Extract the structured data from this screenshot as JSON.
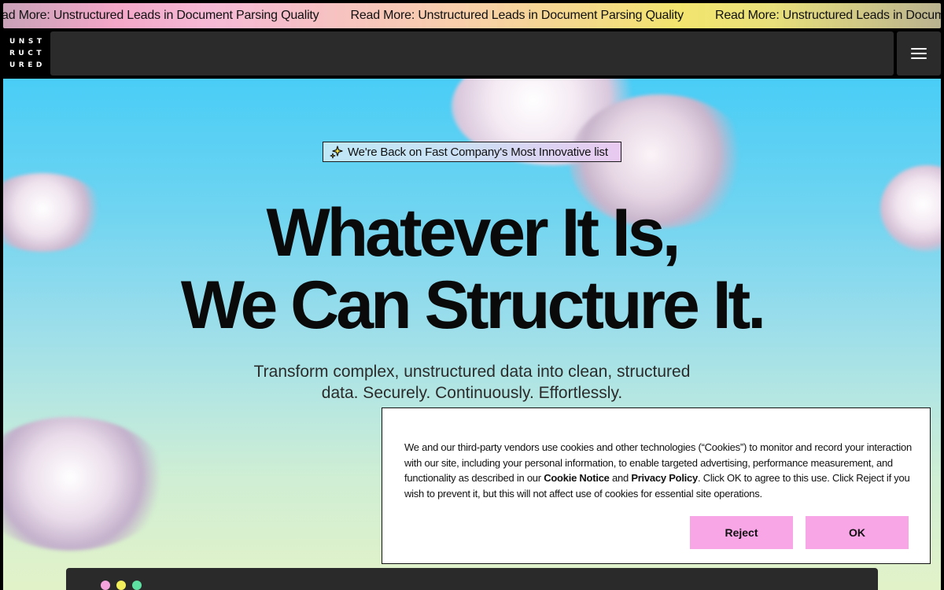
{
  "ticker": {
    "items": [
      "Read More: Unstructured Leads in Document Parsing Quality",
      "Read More: Unstructured Leads in Document Parsing Quality",
      "Read More: Unstructured Leads in Document Parsing Quality"
    ]
  },
  "logo": {
    "lines": [
      "UNST",
      "RUCT",
      "URED"
    ]
  },
  "nav": {
    "menu_icon": "hamburger-icon"
  },
  "hero": {
    "badge": {
      "icon": "sparkle-icon",
      "text": "We're Back on Fast Company's Most Innovative list"
    },
    "headline_line1": "Whatever It Is,",
    "headline_line2": "We Can Structure It.",
    "subline": "Transform complex, unstructured data into clean, structured data. Securely. Continuously. Effortlessly."
  },
  "window_preview": {
    "dot_colors": [
      "#f4a3dc",
      "#f3ef5c",
      "#5fe0a3"
    ]
  },
  "cookie_banner": {
    "text_part1": "We and our third-party vendors use cookies and other technologies (“Cookies”) to monitor and record your interaction with our site, including your personal information, to enable targeted advertising, performance measurement, and functionality as described in our ",
    "cookie_notice_link": "Cookie Notice",
    "text_and": " and ",
    "privacy_policy_link": "Privacy Policy",
    "text_part2": ". Click OK to agree to this use. Click Reject if you wish to prevent it, but this will not affect use of cookies for essential site operations.",
    "reject_label": "Reject",
    "ok_label": "OK",
    "button_color": "#f8a6e6"
  }
}
